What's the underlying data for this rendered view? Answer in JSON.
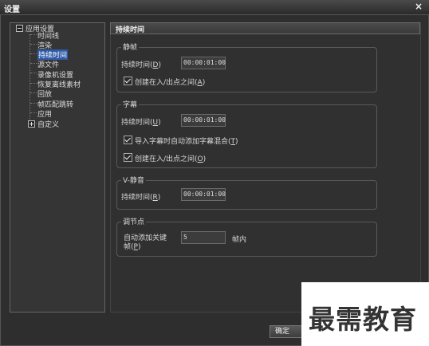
{
  "window": {
    "title": "设置",
    "close_glyph": "×"
  },
  "tree": {
    "root": "应用设置",
    "items": [
      "时间线",
      "渲染",
      "持续时间",
      "源文件",
      "录像机设置",
      "恢复离线素材",
      "回放",
      "帧匹配跳转",
      "应用"
    ],
    "selected": "持续时间",
    "second_root": "自定义"
  },
  "panel": {
    "header": "持续时间",
    "still": {
      "title": "静帧",
      "duration_label": "持续时间(",
      "duration_key": "D",
      "duration_value": "00:00:01:00",
      "checkbox_label": "创建在入/出点之间(",
      "checkbox_key": "A",
      "checkbox_checked": true
    },
    "subtitle": {
      "title": "字幕",
      "duration_label": "持续时间(",
      "duration_key": "U",
      "duration_value": "00:00:01:00",
      "check1_label": "导入字幕时自动添加字幕混合(",
      "check1_key": "T",
      "check1_checked": true,
      "check2_label": "创建在入/出点之间(",
      "check2_key": "O",
      "check2_checked": true
    },
    "vmute": {
      "title": "V-静音",
      "duration_label": "持续时间(",
      "duration_key": "R",
      "duration_value": "00:00:01:00"
    },
    "keypoint": {
      "title": "调节点",
      "label_line1": "自动添加关键",
      "label_line2": "帧(",
      "label_key": "P",
      "value": "5",
      "unit": "帧内"
    }
  },
  "buttons": {
    "ok": "确定"
  },
  "watermark": "最需教育"
}
